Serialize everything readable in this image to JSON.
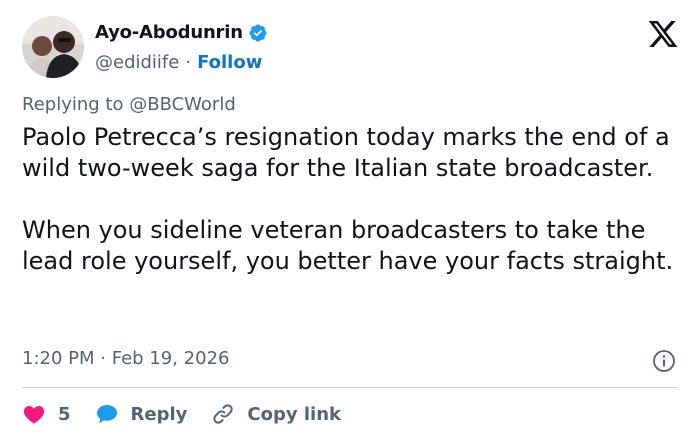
{
  "user": {
    "display_name": "Ayo-Abodunrin",
    "handle": "@edidiife",
    "separator": "·",
    "follow_label": "Follow"
  },
  "reply_context": {
    "prefix": "Replying to",
    "target": "@BBCWorld"
  },
  "tweet": {
    "paragraphs": [
      "Paolo Petrecca’s resignation today marks the end of a wild two-week saga for the Italian state broadcaster.",
      "When you sideline veteran broadcasters to take the lead role yourself, you better have your facts straight."
    ],
    "time": "1:20 PM",
    "date": "Feb 19, 2026",
    "meta_separator": "·"
  },
  "actions": {
    "like_count": "5",
    "reply_label": "Reply",
    "copy_link_label": "Copy link"
  },
  "icons": {
    "verified": "verified-badge-icon",
    "brand": "x-logo-icon",
    "info": "info-icon",
    "like": "heart-icon",
    "reply": "chat-bubble-icon",
    "copy": "link-icon"
  },
  "colors": {
    "text": "#0f1419",
    "secondary": "#536471",
    "link": "#0f73c7",
    "verified": "#1d9bf0",
    "like": "#f91880",
    "reply": "#1d9bf0",
    "divider": "#cfd9de"
  }
}
